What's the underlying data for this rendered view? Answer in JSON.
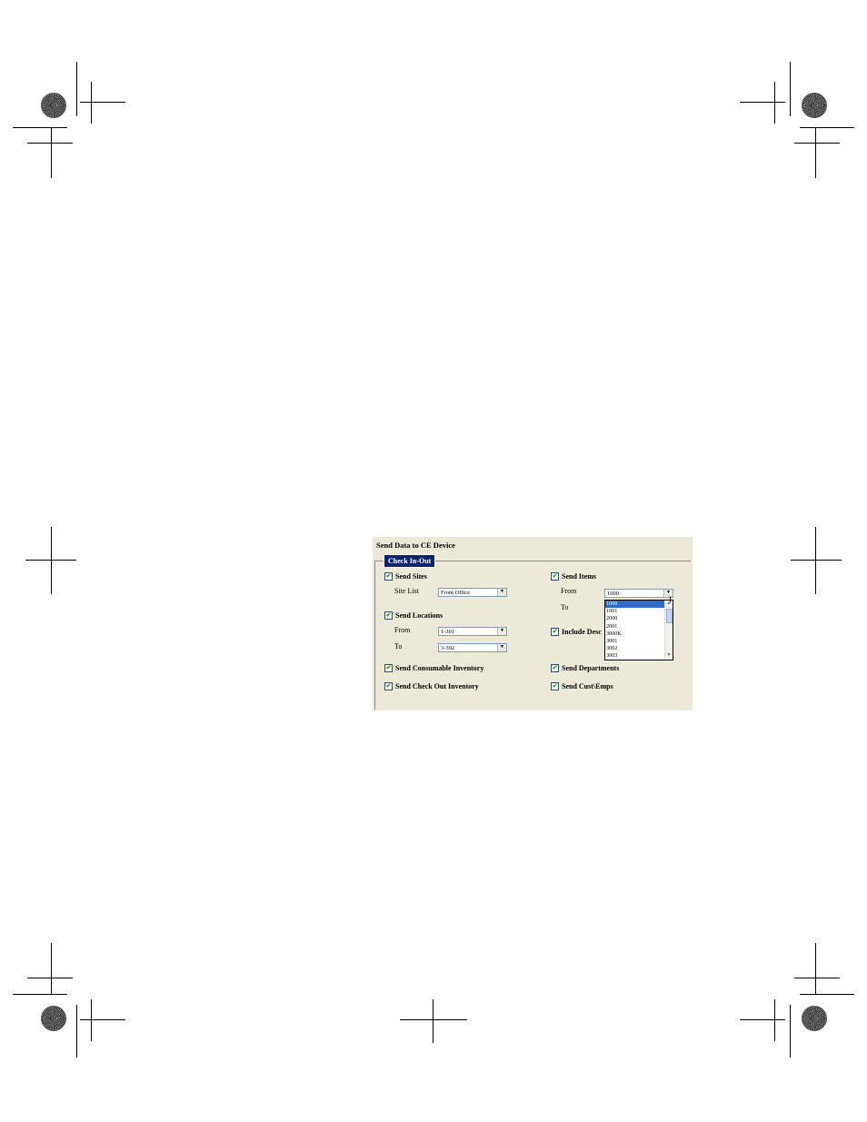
{
  "dialog": {
    "title": "Send Data to CE Device",
    "tab_label": "Check In-Out",
    "send_sites": {
      "label": "Send Sites",
      "checked": true
    },
    "site_list": {
      "label": "Site List",
      "value": "Front Office"
    },
    "send_locations": {
      "label": "Send Locations",
      "checked": true
    },
    "locations_from": {
      "label": "From",
      "value": "1-301"
    },
    "locations_to": {
      "label": "To",
      "value": "3-302"
    },
    "send_consumable": {
      "label": "Send Consumable Inventory",
      "checked": true
    },
    "send_check_out": {
      "label": "Send Check Out Inventory",
      "checked": true
    },
    "send_items": {
      "label": "Send Items",
      "checked": true
    },
    "items_from": {
      "label": "From",
      "value": "1000"
    },
    "items_to": {
      "label": "To"
    },
    "include_desc": {
      "label": "Include Desc",
      "checked": true
    },
    "send_departments": {
      "label": "Send Departments",
      "checked": true
    },
    "send_cust_emps": {
      "label": "Send Cust\\Emps",
      "checked": true
    },
    "dropdown_options": [
      "1000",
      "1001",
      "2000",
      "2001",
      "3000K",
      "3001",
      "3002",
      "3003"
    ],
    "selected_option": "1000"
  },
  "icons": {
    "checkmark": "✔",
    "combo_arrow": "▼",
    "scroll_up": "▲",
    "scroll_down": "▼",
    "cursor": "I"
  }
}
